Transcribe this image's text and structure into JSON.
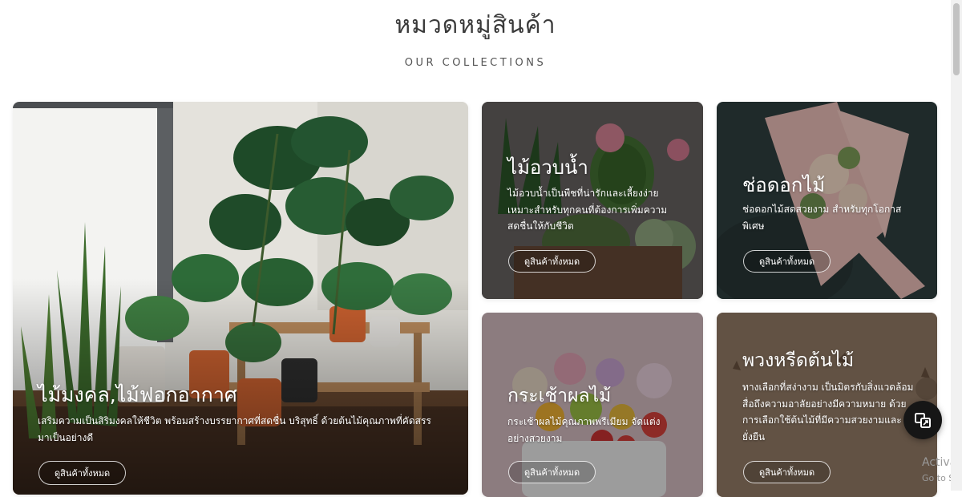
{
  "section": {
    "title": "หมวดหมู่สินค้า",
    "subtitle": "OUR COLLECTIONS"
  },
  "cards": [
    {
      "title": "ไม้มงคล,ไม้ฟอกอากาศ",
      "description": "เสริมความเป็นสิริมงคลให้ชีวิต พร้อมสร้างบรรยากาศที่สดชื่น บริสุทธิ์ ด้วยต้นไม้คุณภาพที่คัดสรรมาเป็นอย่างดี",
      "button_label": "ดูสินค้าทั้งหมด"
    },
    {
      "title": "ไม้อวบน้ำ",
      "description": "ไม้อวบน้ำเป็นพืชที่น่ารักและเลี้ยงง่าย เหมาะสำหรับทุกคนที่ต้องการเพิ่มความสดชื่นให้กับชีวิต",
      "button_label": "ดูสินค้าทั้งหมด"
    },
    {
      "title": "ช่อดอกไม้",
      "description": "ช่อดอกไม้สดสวยงาม สำหรับทุกโอกาสพิเศษ",
      "button_label": "ดูสินค้าทั้งหมด"
    },
    {
      "title": "กระเช้าผลไม้",
      "description": "กระเช้าผลไม้คุณภาพพรีเมียม จัดแต่งอย่างสวยงาม",
      "button_label": "ดูสินค้าทั้งหมด"
    },
    {
      "title": "พวงหรีดต้นไม้",
      "description": "ทางเลือกที่สง่างาม เป็นมิตรกับสิ่งแวดล้อม สื่อถึงความอาลัยอย่างมีความหมาย ด้วยการเลือกใช้ต้นไม้ที่มีความสวยงามและยั่งยืน",
      "button_label": "ดูสินค้าทั้งหมด"
    }
  ],
  "fab": {
    "icon": "chat-share-icon"
  },
  "watermark": {
    "line1": "Activat",
    "line2": "Go to Set"
  }
}
